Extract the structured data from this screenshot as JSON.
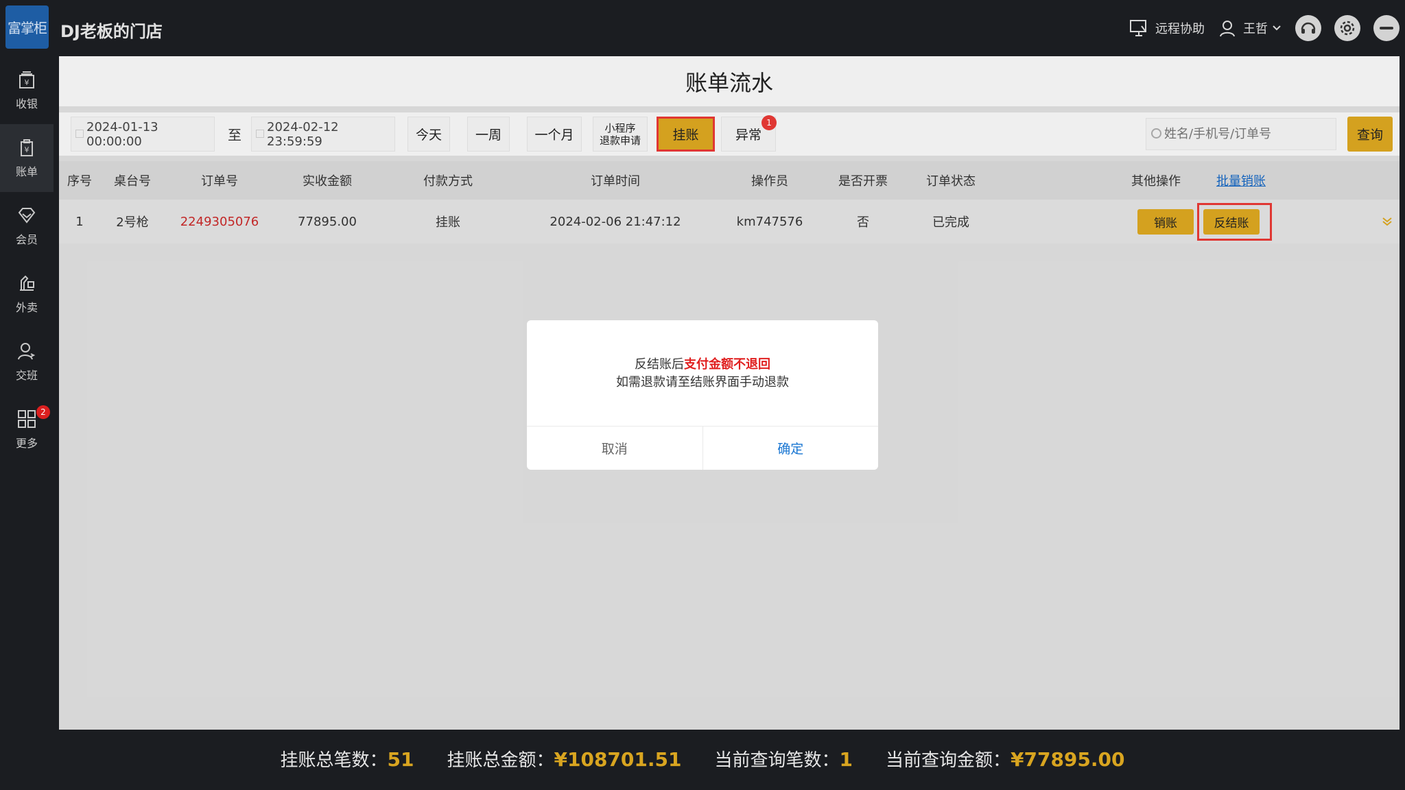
{
  "app": {
    "logo_text": "富掌柜",
    "store_name": "DJ老板的门店"
  },
  "topbar": {
    "remote_assist": "远程协助",
    "user_name": "王哲"
  },
  "sidebar": {
    "items": [
      {
        "label": "收银",
        "icon": "cashier-icon"
      },
      {
        "label": "账单",
        "icon": "bill-icon"
      },
      {
        "label": "会员",
        "icon": "member-icon"
      },
      {
        "label": "外卖",
        "icon": "delivery-icon"
      },
      {
        "label": "交班",
        "icon": "shift-icon"
      },
      {
        "label": "更多",
        "icon": "more-grid-icon",
        "badge": "2"
      }
    ]
  },
  "page": {
    "title": "账单流水"
  },
  "filters": {
    "start_date": "2024-01-13 00:00:00",
    "separator": "至",
    "end_date": "2024-02-12 23:59:59",
    "today": "今天",
    "week": "一周",
    "month": "一个月",
    "refund_line1": "小程序",
    "refund_line2": "退款申请",
    "credit": "挂账",
    "abnormal": "异常",
    "abnormal_badge": "1",
    "search_placeholder": "姓名/手机号/订单号",
    "query": "查询"
  },
  "table": {
    "headers": {
      "seq": "序号",
      "table_no": "桌台号",
      "order_no": "订单号",
      "amount": "实收金额",
      "pay_method": "付款方式",
      "order_time": "订单时间",
      "operator": "操作员",
      "invoice": "是否开票",
      "status": "订单状态",
      "other_ops": "其他操作",
      "batch": "批量销账"
    },
    "rows": [
      {
        "seq": "1",
        "table_no": "2号枪",
        "order_no": "2249305076",
        "amount": "77895.00",
        "pay_method": "挂账",
        "order_time": "2024-02-06 21:47:12",
        "operator": "km747576",
        "invoice": "否",
        "status": "已完成",
        "writeoff": "销账",
        "reverse": "反结账"
      }
    ]
  },
  "modal": {
    "msg_prefix": "反结账后",
    "msg_warn": "支付金额不退回",
    "msg_line2": "如需退款请至结账界面手动退款",
    "cancel": "取消",
    "confirm": "确定"
  },
  "footer": {
    "credit_count_label": "挂账总笔数：",
    "credit_count": "51",
    "credit_amount_label": "挂账总金额：",
    "credit_amount": "¥108701.51",
    "query_count_label": "当前查询笔数：",
    "query_count": "1",
    "query_amount_label": "当前查询金额：",
    "query_amount": "¥77895.00"
  },
  "colors": {
    "accent": "#d9a520",
    "danger": "#e53935",
    "link": "#1565c0"
  }
}
